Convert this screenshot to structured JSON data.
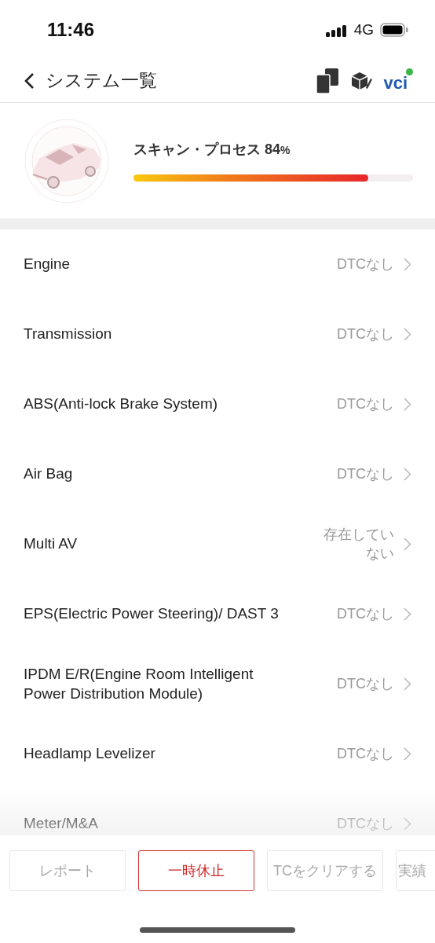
{
  "status_bar": {
    "time": "11:46",
    "network": "4G"
  },
  "header": {
    "title": "システム一覧",
    "vci": "vci"
  },
  "scan": {
    "label": "スキャン・プロセス 84",
    "unit": "%",
    "level": 0.84
  },
  "systems": [
    {
      "name": "Engine",
      "status": "DTCなし"
    },
    {
      "name": "Transmission",
      "status": "DTCなし"
    },
    {
      "name": "ABS(Anti-lock Brake System)",
      "status": "DTCなし"
    },
    {
      "name": "Air Bag",
      "status": "DTCなし"
    },
    {
      "name": "Multi AV",
      "status": "存在していない"
    },
    {
      "name": "EPS(Electric Power Steering)/ DAST 3",
      "status": "DTCなし"
    },
    {
      "name": "IPDM E/R(Engine Room Intelligent Power Distribution Module)",
      "status": "DTCなし"
    },
    {
      "name": "Headlamp Levelizer",
      "status": "DTCなし"
    },
    {
      "name": "Meter/M&A",
      "status": "DTCなし"
    }
  ],
  "actions": [
    {
      "label": "レポート",
      "disabled": true
    },
    {
      "label": "一時休止",
      "disabled": false
    },
    {
      "label": "TCをクリアする",
      "disabled": true
    },
    {
      "label": "実績",
      "disabled": true
    }
  ]
}
